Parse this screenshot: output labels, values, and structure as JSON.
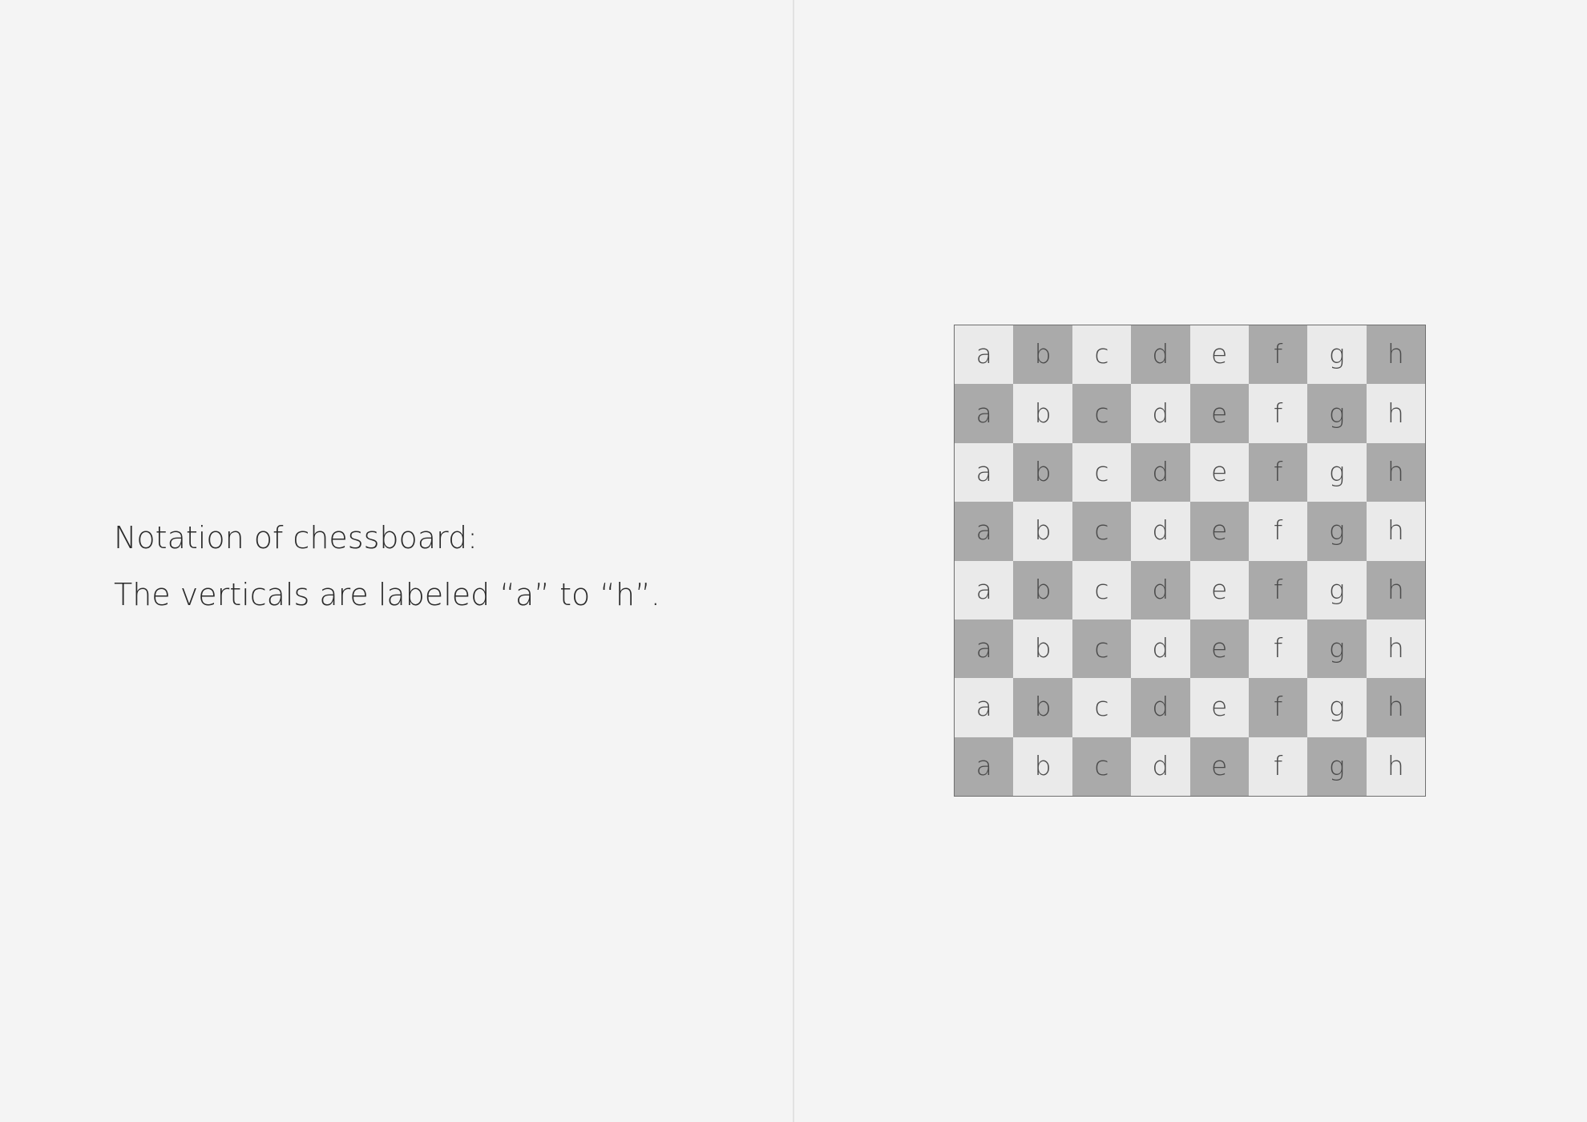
{
  "caption": {
    "line1": "Notation of chessboard:",
    "line2": "The verticals are labeled “a” to “h”."
  },
  "board": {
    "files": [
      "a",
      "b",
      "c",
      "d",
      "e",
      "f",
      "g",
      "h"
    ],
    "ranks": 8,
    "colors": {
      "light": "#eaeaea",
      "dark": "#aaaaaa",
      "text": "#4a4a4a",
      "border": "#6f6f6f"
    }
  }
}
